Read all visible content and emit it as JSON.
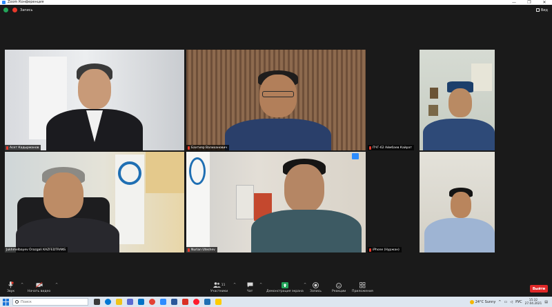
{
  "window": {
    "title": "Zoom Конференция",
    "controls": [
      "—",
      "❐",
      "✕"
    ]
  },
  "topbar": {
    "recording_label": "Запись",
    "view_label": "Вид"
  },
  "participants": [
    {
      "name": "Асет Кадырманов"
    },
    {
      "name": "Бахтияр Валиханович"
    },
    {
      "name": "ПЧГ-62 Аймбаев Кайрат"
    },
    {
      "name": "Jukhmelbayev Orazgali KAZFEDTRANS"
    },
    {
      "name": "Nurlan Uteshev"
    },
    {
      "name": "iPhone (Нуржан)"
    }
  ],
  "toolbar": {
    "audio": "Звук",
    "video": "Начать видео",
    "participants": "Участники",
    "participants_count": "11",
    "chat": "Чат",
    "share": "Демонстрация экрана",
    "record": "Запись",
    "reactions": "Реакции",
    "apps": "Приложения",
    "leave": "Выйти"
  },
  "taskbar": {
    "search_placeholder": "Поиск",
    "weather": "24°C  Sunny",
    "lang": "РУС",
    "time": "15:32",
    "date": "27.04.2021"
  },
  "colors": {
    "accent": "#2d8cff",
    "active_speaker": "#e6d51a",
    "leave": "#e02828",
    "recording": "#e8392b",
    "encryption": "#23a55a"
  }
}
